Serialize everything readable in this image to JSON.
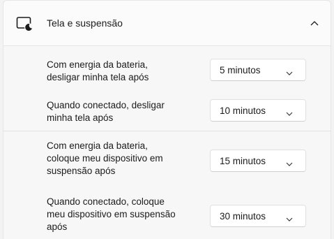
{
  "section": {
    "title": "Tela e suspensão",
    "icon": "display-sleep-icon",
    "collapse_icon": "chevron-up-icon"
  },
  "settings": [
    {
      "label": "Com energia da bateria,\ndesligar minha tela após",
      "value": "5 minutos",
      "chevron_icon": "chevron-down-icon"
    },
    {
      "label": "Quando conectado, desligar\nminha tela após",
      "value": "10 minutos",
      "chevron_icon": "chevron-down-icon"
    },
    {
      "label": "Com energia da bateria,\ncoloque meu dispositivo em\nsuspensão após",
      "value": "15 minutos",
      "chevron_icon": "chevron-down-icon"
    },
    {
      "label": "Quando conectado, coloque\nmeu dispositivo em suspensão\napós",
      "value": "30 minutos",
      "chevron_icon": "chevron-down-icon"
    }
  ]
}
